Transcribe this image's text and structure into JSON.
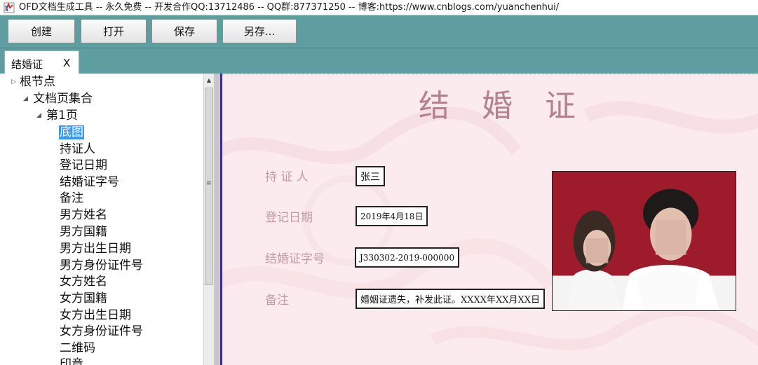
{
  "window": {
    "title": "OFD文档生成工具 -- 永久免费 -- 开发合作QQ:13712486 -- QQ群:877371250 -- 博客:https://www.cnblogs.com/yuanchenhui/",
    "icon": "app-logo-icon"
  },
  "toolbar": {
    "create_label": "创建",
    "open_label": "打开",
    "save_label": "保存",
    "save_as_label": "另存..."
  },
  "tabs": [
    {
      "label": "结婚证",
      "close": "X"
    }
  ],
  "tree": {
    "root": "根节点",
    "pages_collection": "文档页集合",
    "page1": "第1页",
    "items": [
      "底图",
      "持证人",
      "登记日期",
      "结婚证字号",
      "备注",
      "男方姓名",
      "男方国籍",
      "男方出生日期",
      "男方身份证件号",
      "女方姓名",
      "女方国籍",
      "女方出生日期",
      "女方身份证件号",
      "二维码",
      "印章"
    ],
    "selected": "底图"
  },
  "document": {
    "title": "结婚证",
    "fields": [
      {
        "label": "持 证 人",
        "value": "张三"
      },
      {
        "label": "登记日期",
        "value": "2019年4月18日"
      },
      {
        "label": "结婚证字号",
        "value": "J330302-2019-000000"
      },
      {
        "label": "备注",
        "value": "婚姻证遗失，补发此证。XXXX年XX月XX日"
      }
    ],
    "photo": "couple-photo"
  },
  "colors": {
    "toolbar_bg": "#5f9ea0",
    "doc_bg": "#fbebee",
    "doc_title": "#b4818e",
    "doc_label": "#c39aa5",
    "selection": "#3399ff",
    "photo_bg": "#9e1b2c"
  }
}
